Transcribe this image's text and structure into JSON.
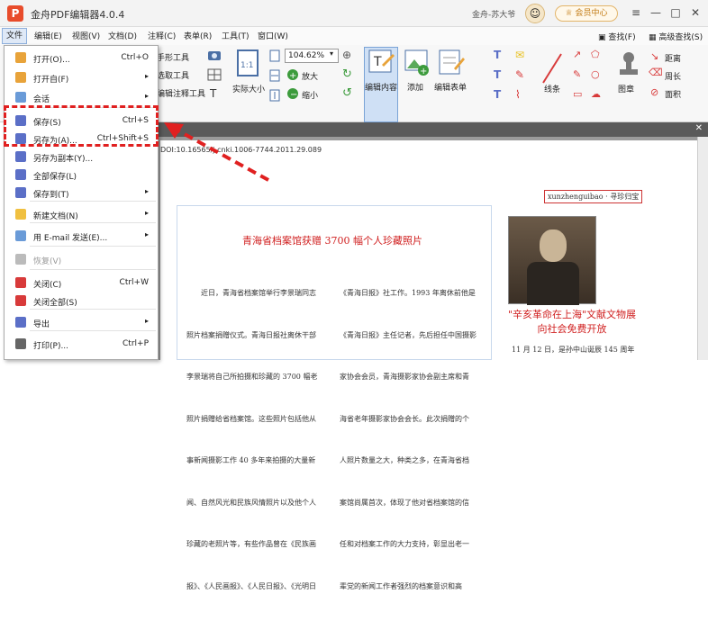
{
  "app": {
    "title": "金舟PDF编辑器4.0.4",
    "logo": "P",
    "user": "金舟-苏大爷",
    "vip_label": "会员中心"
  },
  "window": {
    "menu_icon": "≡",
    "minimize_icon": "—",
    "restore_icon": "□",
    "close_icon": "✕"
  },
  "menubar": [
    "文件",
    "编辑(E)",
    "视图(V)",
    "文档(D)",
    "注释(C)",
    "表单(R)",
    "工具(T)",
    "窗口(W)"
  ],
  "toolbar": {
    "hand_tool": "手形工具",
    "select_text": "选取工具",
    "edit_annot_tool": "编辑注释工具",
    "actual_size": "实际大小",
    "actual_size_badge": "1:1",
    "zoom_value": "104.62%",
    "zoom_in": "放大",
    "zoom_out": "缩小",
    "edit_content": "编辑内容",
    "add": "添加",
    "edit_form": "编辑表单",
    "line_tool": "线条",
    "stamp": "图章",
    "find": "查找(F)",
    "advanced_find": "高级查找(S)",
    "distance": "距离",
    "perimeter": "周长",
    "area": "面积"
  },
  "file_menu": [
    {
      "label": "打开(O)...",
      "shortcut": "Ctrl+O",
      "arrow": "",
      "color": "#e8a33a"
    },
    {
      "label": "打开自(F)",
      "shortcut": "",
      "arrow": "▸",
      "color": "#e8a33a"
    },
    {
      "label": "会话",
      "shortcut": "",
      "arrow": "▸",
      "color": "#6a9bd8"
    },
    {
      "label": "保存(S)",
      "shortcut": "Ctrl+S",
      "arrow": "",
      "color": "#5b6fc7"
    },
    {
      "label": "另存为(A)...",
      "shortcut": "Ctrl+Shift+S",
      "arrow": "",
      "color": "#5b6fc7"
    },
    {
      "label": "另存为副本(Y)...",
      "shortcut": "",
      "arrow": "",
      "color": "#5b6fc7"
    },
    {
      "label": "全部保存(L)",
      "shortcut": "",
      "arrow": "",
      "color": "#5b6fc7"
    },
    {
      "label": "保存到(T)",
      "shortcut": "",
      "arrow": "▸",
      "color": "#5b6fc7"
    },
    {
      "label": "新建文档(N)",
      "shortcut": "",
      "arrow": "▸",
      "color": "#f0c040"
    },
    {
      "label": "用 E-mail 发送(E)...",
      "shortcut": "",
      "arrow": "▸",
      "color": "#6a9bd8"
    },
    {
      "label": "恢复(V)",
      "shortcut": "",
      "arrow": "",
      "color": "#bbbbbb"
    },
    {
      "label": "关闭(C)",
      "shortcut": "Ctrl+W",
      "arrow": "",
      "color": "#d83a3a"
    },
    {
      "label": "关闭全部(S)",
      "shortcut": "",
      "arrow": "",
      "color": "#d83a3a"
    },
    {
      "label": "导出",
      "shortcut": "",
      "arrow": "▸",
      "color": "#5b6fc7"
    },
    {
      "label": "打印(P)...",
      "shortcut": "Ctrl+P",
      "arrow": "",
      "color": "#666666"
    }
  ],
  "document": {
    "doi": "DOI:10.16565/j.cnki.1006-7744.2011.29.089",
    "tag": "xunzhenguibao · 寻珍归宝",
    "article_title": "青海省档案馆获赠 3700 幅个人珍藏照片",
    "col1": [
      "　　近日，青海省档案馆举行李景瑞同志",
      "照片档案捐赠仪式。青海日报社离休干部",
      "李景瑞将自己所拍摄和珍藏的 3700 幅老",
      "照片捐赠给省档案馆。这些照片包括他从",
      "事新闻摄影工作 40 多年来拍摄的大量新",
      "闻、自然风光和民族风情照片以及他个人",
      "珍藏的老照片等，有些作品曾在《民族画",
      "报》、《人民画报》、《人民日报》、《光明日"
    ],
    "col2": [
      "《青海日报》社工作。1993 年离休前他是",
      "《青海日报》主任记者，先后担任中国摄影",
      "家协会会员，青海摄影家协会副主席和青",
      "海省老年摄影家协会会长。此次捐赠的个",
      "人照片数量之大，种类之多，在青海省档",
      "案馆尚属首次，体现了他对省档案馆的信",
      "任和对档案工作的大力支持，彰显出老一",
      "辈党的新闻工作者强烈的档案意识和高"
    ],
    "news_title": "\"辛亥革命在上海\"文献文物展向社会免费开放",
    "news_body": "11 月 12 日，是孙中山诞辰 145 周年"
  },
  "tabstrip": {
    "close": "✕"
  },
  "colors": {
    "highlight": "#e02020",
    "title_red": "#d02020",
    "menu_active": "#dfe9f7"
  }
}
